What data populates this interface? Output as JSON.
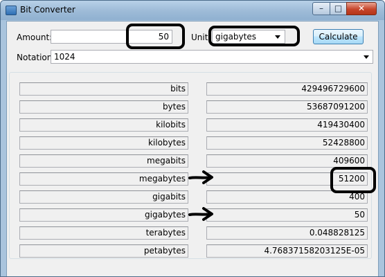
{
  "window": {
    "title": "Bit Converter",
    "minimize_glyph": "–",
    "maximize_glyph": "□",
    "close_glyph": "✕"
  },
  "form": {
    "amount_label": "Amount:",
    "amount_value": "50",
    "unit_label": "Unit:",
    "unit_value": "gigabytes",
    "calculate_label": "Calculate",
    "notation_label": "Notation:",
    "notation_value": "1024"
  },
  "results": [
    {
      "unit": "bits",
      "value": "429496729600"
    },
    {
      "unit": "bytes",
      "value": "53687091200"
    },
    {
      "unit": "kilobits",
      "value": "419430400"
    },
    {
      "unit": "kilobytes",
      "value": "52428800"
    },
    {
      "unit": "megabits",
      "value": "409600"
    },
    {
      "unit": "megabytes",
      "value": "51200"
    },
    {
      "unit": "gigabits",
      "value": "400"
    },
    {
      "unit": "gigabytes",
      "value": "50"
    },
    {
      "unit": "terabytes",
      "value": "0.048828125"
    },
    {
      "unit": "petabytes",
      "value": "4.76837158203125E-05"
    }
  ]
}
